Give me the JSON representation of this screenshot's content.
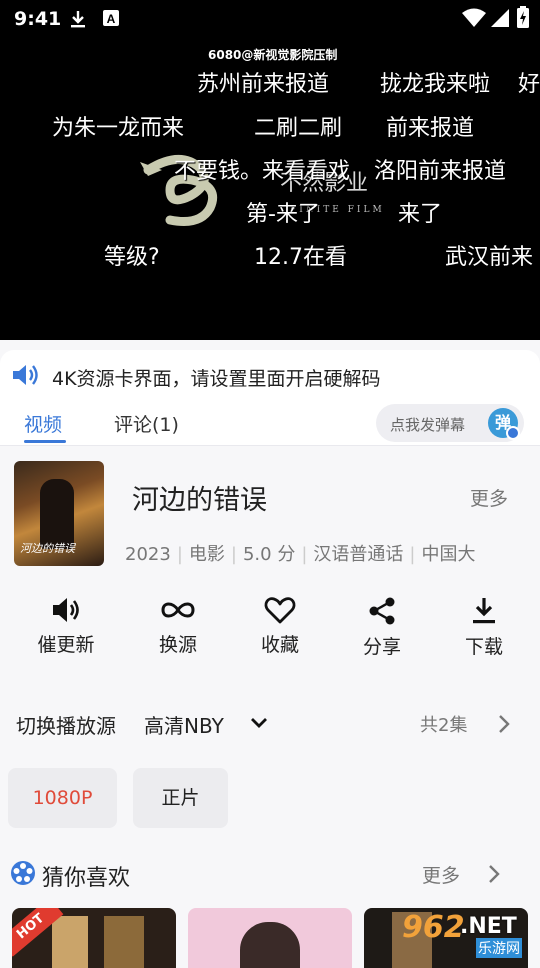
{
  "status_bar": {
    "time": "9:41",
    "left_icons": [
      "download-icon",
      "a-notification-icon"
    ],
    "right_icons": [
      "wifi-icon",
      "battery-charging-icon"
    ]
  },
  "player": {
    "watermark": "6080@新视觉影院压制",
    "logo_text_cn": "不然影业",
    "logo_text_en": "FINITE FILM",
    "danmaku": [
      "苏州前来报道",
      "拢龙我来啦",
      "好",
      "为朱一龙而来",
      "二刷二刷",
      "前来报道",
      "不要钱。来看看戏",
      "洛阳前来报道",
      "第-来了",
      "来了",
      "等级?",
      "12.7在看",
      "武汉前来"
    ]
  },
  "notice": {
    "icon": "speaker-icon",
    "text": "4K资源卡界面，请设置里面开启硬解码"
  },
  "tabs": {
    "video": "视频",
    "comments": "评论(1)",
    "danmaku_placeholder": "点我发弹幕",
    "danmaku_button": "弹"
  },
  "movie": {
    "poster_title": "河边的错误",
    "title": "河边的错误",
    "more": "更多",
    "year": "2023",
    "category": "电影",
    "score": "5.0 分",
    "language": "汉语普通话",
    "region": "中国大"
  },
  "actions": [
    {
      "label": "催更新",
      "icon": "speaker-icon"
    },
    {
      "label": "换源",
      "icon": "infinity-icon"
    },
    {
      "label": "收藏",
      "icon": "heart-icon"
    },
    {
      "label": "分享",
      "icon": "share-icon"
    },
    {
      "label": "下载",
      "icon": "download-icon"
    }
  ],
  "source": {
    "label": "切换播放源",
    "current": "高清NBY",
    "episodes_count": "共2集"
  },
  "episodes": [
    {
      "label": "1080P",
      "active": true
    },
    {
      "label": "正片",
      "active": false
    }
  ],
  "recommend": {
    "title": "猜你喜欢",
    "more": "更多",
    "hot_badge": "HOT",
    "site_badge_num": "962",
    "site_badge_suffix": ".NET",
    "site_badge_name": "乐游网"
  },
  "colors": {
    "accent_blue": "#3a78d8",
    "active_red": "#e04b3a",
    "player_bg": "#000000"
  }
}
